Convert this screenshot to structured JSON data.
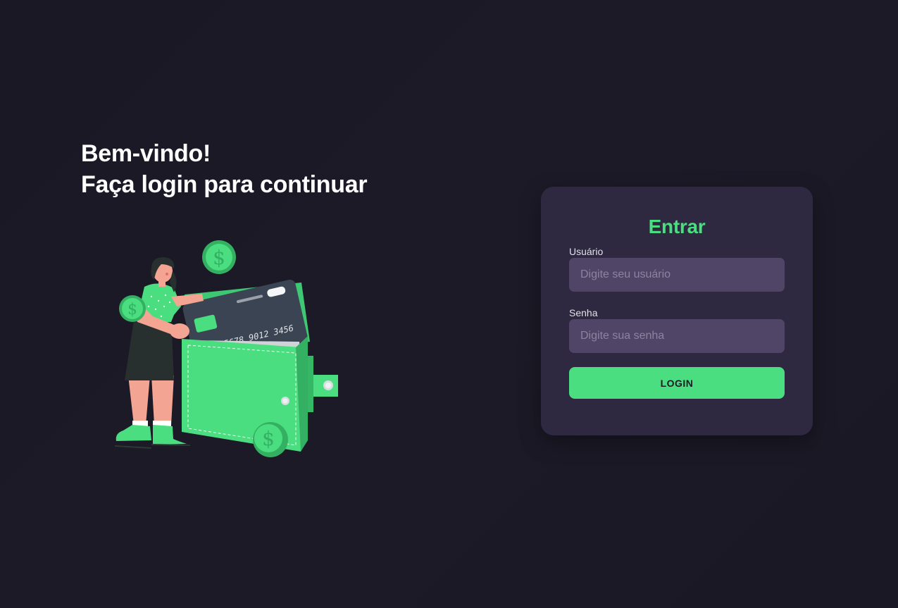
{
  "welcome": {
    "line1": "Bem-vindo!",
    "line2": "Faça login para continuar"
  },
  "illustration": {
    "card_number": "1234 5678 9012 3456",
    "coin_symbol": "$"
  },
  "login_form": {
    "title": "Entrar",
    "username_label": "Usuário",
    "username_placeholder": "Digite seu usuário",
    "password_label": "Senha",
    "password_placeholder": "Digite sua senha",
    "submit_label": "LOGIN"
  },
  "colors": {
    "background": "#1b1826",
    "card_background": "#2e2940",
    "input_background": "#504566",
    "accent_green": "#4ade80",
    "text_white": "#ffffff"
  }
}
